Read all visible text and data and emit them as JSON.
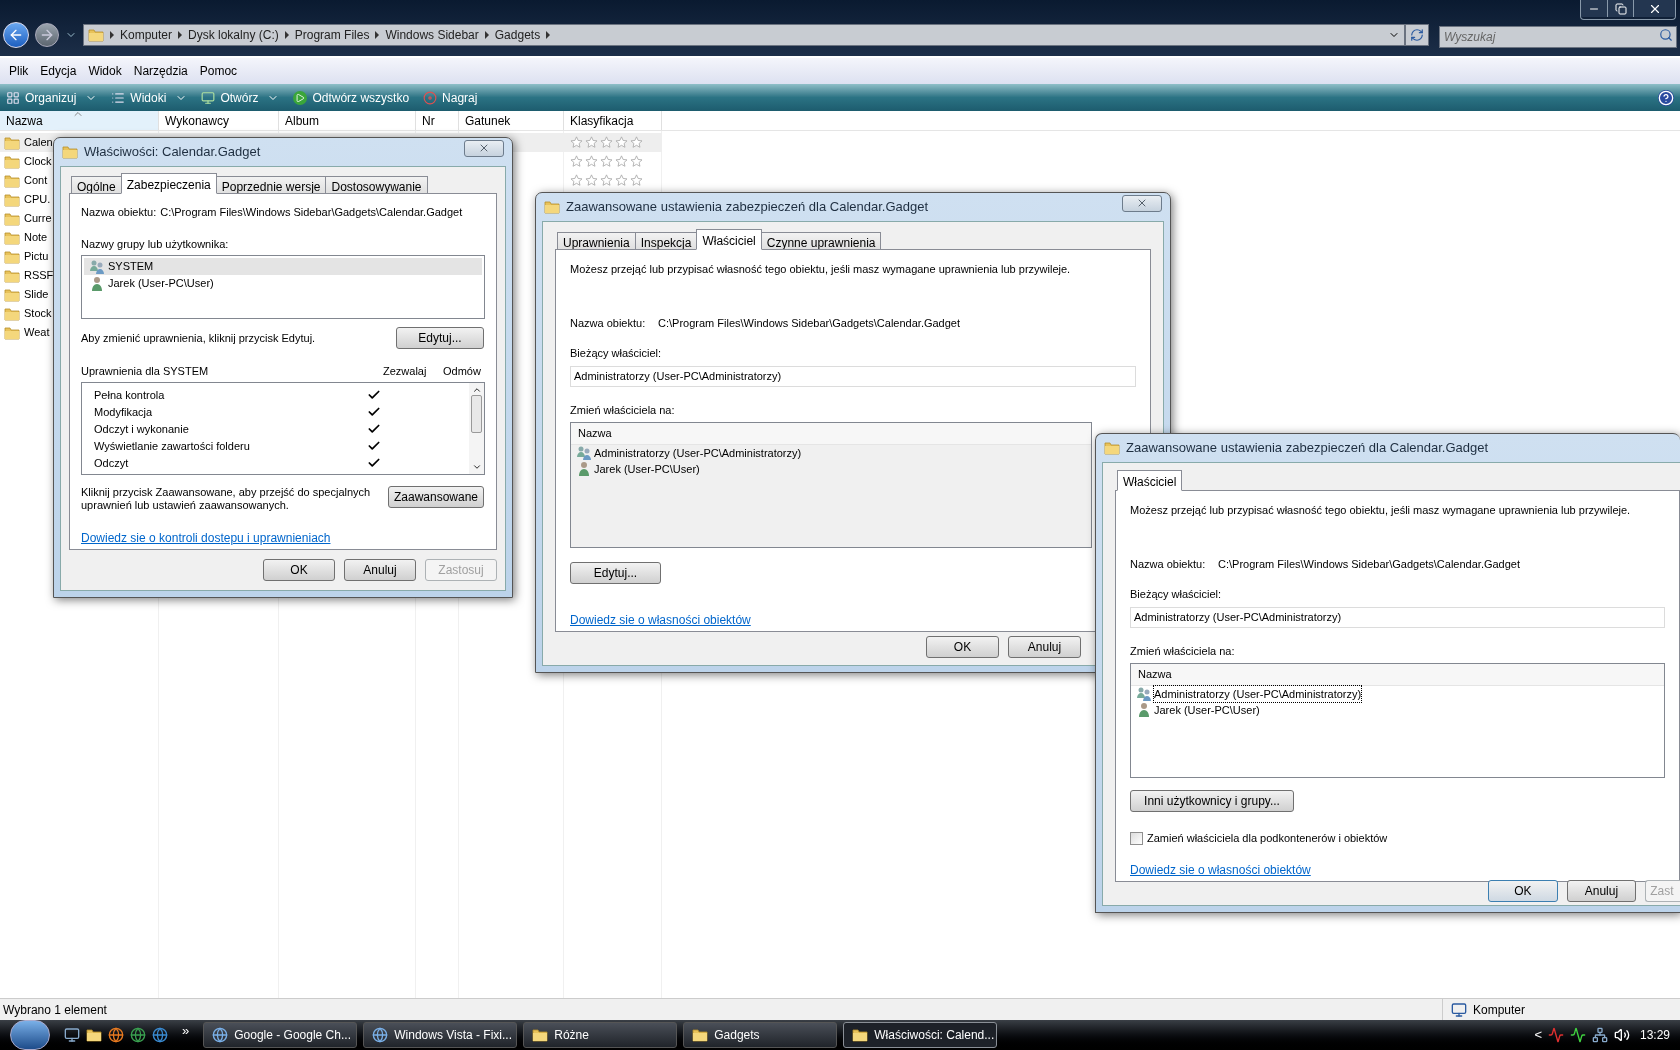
{
  "explorer": {
    "address": [
      "Komputer",
      "Dysk lokalny (C:)",
      "Program Files",
      "Windows Sidebar",
      "Gadgets"
    ],
    "search": {
      "placeholder": "Wyszukaj"
    },
    "menu": [
      "Plik",
      "Edycja",
      "Widok",
      "Narzędzia",
      "Pomoc"
    ],
    "toolbar": [
      {
        "label": "Organizuj",
        "kind": "organize",
        "dropdown": true
      },
      {
        "label": "Widoki",
        "kind": "views",
        "dropdown": true
      },
      {
        "label": "Otwórz",
        "kind": "open",
        "dropdown": true
      },
      {
        "label": "Odtwórz wszystko",
        "kind": "play",
        "dropdown": false
      },
      {
        "label": "Nagraj",
        "kind": "burn",
        "dropdown": false
      }
    ],
    "columns": [
      {
        "label": "Nazwa",
        "sorted": true
      },
      {
        "label": "Wykonawcy",
        "sorted": false
      },
      {
        "label": "Album",
        "sorted": false
      },
      {
        "label": "Nr",
        "sorted": false
      },
      {
        "label": "Gatunek",
        "sorted": false
      },
      {
        "label": "Klasyfikacja",
        "sorted": false
      }
    ],
    "files": [
      {
        "name": "Calen",
        "selected": true,
        "stars": 0
      },
      {
        "name": "Clock",
        "selected": false,
        "stars": 0
      },
      {
        "name": "Cont",
        "selected": false,
        "stars": 0
      },
      {
        "name": "CPU.",
        "selected": false
      },
      {
        "name": "Curre",
        "selected": false
      },
      {
        "name": "Note",
        "selected": false
      },
      {
        "name": "Pictu",
        "selected": false
      },
      {
        "name": "RSSF",
        "selected": false
      },
      {
        "name": "Slide",
        "selected": false
      },
      {
        "name": "Stock",
        "selected": false
      },
      {
        "name": "Weat",
        "selected": false
      }
    ],
    "status_bar": {
      "selection": "Wybrano 1 element",
      "location": "Komputer"
    }
  },
  "properties_dialog": {
    "title": "Właściwości: Calendar.Gadget",
    "tabs": [
      {
        "label": "Ogólne",
        "selected": false
      },
      {
        "label": "Zabezpieczenia",
        "selected": true
      },
      {
        "label": "Poprzednie wersje",
        "selected": false
      },
      {
        "label": "Dostosowywanie",
        "selected": false
      }
    ],
    "object_label": "Nazwa obiektu:",
    "object_name": "C:\\Program Files\\Windows Sidebar\\Gadgets\\Calendar.Gadget",
    "users_label": "Nazwy grupy lub użytkownika:",
    "users": [
      {
        "name": "SYSTEM",
        "kind": "group",
        "selected": true
      },
      {
        "name": "Jarek (User-PC\\User)",
        "kind": "user",
        "selected": false
      }
    ],
    "edit_hint": "Aby zmienić uprawnienia, kliknij przycisk Edytuj.",
    "edit_button": "Edytuj...",
    "permissions_label": "Uprawnienia dla SYSTEM",
    "allow_label": "Zezwalaj",
    "deny_label": "Odmów",
    "permissions": [
      {
        "name": "Pełna kontrola",
        "allow": true,
        "deny": false
      },
      {
        "name": "Modyfikacja",
        "allow": true,
        "deny": false
      },
      {
        "name": "Odczyt i wykonanie",
        "allow": true,
        "deny": false
      },
      {
        "name": "Wyświetlanie zawartości folderu",
        "allow": true,
        "deny": false
      },
      {
        "name": "Odczyt",
        "allow": true,
        "deny": false
      }
    ],
    "advanced_hint": "Kliknij przycisk Zaawansowane, aby przejść do specjalnych uprawnień lub ustawień zaawansowanych.",
    "advanced_button": "Zaawansowane",
    "link": "Dowiedz sie o kontroli dostepu i uprawnieniach",
    "buttons": [
      {
        "label": "OK",
        "disabled": false
      },
      {
        "label": "Anuluj",
        "disabled": false
      },
      {
        "label": "Zastosuj",
        "disabled": true
      }
    ]
  },
  "advanced_dialog": {
    "title": "Zaawansowane ustawienia zabezpieczeń dla Calendar.Gadget",
    "tabs": [
      {
        "label": "Uprawnienia",
        "selected": false
      },
      {
        "label": "Inspekcja",
        "selected": false
      },
      {
        "label": "Właściciel",
        "selected": true
      },
      {
        "label": "Czynne uprawnienia",
        "selected": false
      }
    ],
    "intro": "Możesz przejąć lub przypisać własność tego obiektu, jeśli masz wymagane uprawnienia lub przywileje.",
    "object_label": "Nazwa obiektu:",
    "object_name": "C:\\Program Files\\Windows Sidebar\\Gadgets\\Calendar.Gadget",
    "owner_label": "Bieżący właściciel:",
    "owner": "Administratorzy (User-PC\\Administratorzy)",
    "change_label": "Zmień właściciela na:",
    "list_header": "Nazwa",
    "candidates": [
      {
        "name": "Administratorzy (User-PC\\Administratorzy)",
        "kind": "group"
      },
      {
        "name": "Jarek (User-PC\\User)",
        "kind": "user"
      }
    ],
    "edit_button": "Edytuj...",
    "link": "Dowiedz sie o własności obiektów",
    "buttons": [
      {
        "label": "OK"
      },
      {
        "label": "Anuluj"
      }
    ]
  },
  "owner_dialog": {
    "title": "Zaawansowane ustawienia zabezpieczeń dla Calendar.Gadget",
    "tabs": [
      {
        "label": "Właściciel",
        "selected": true
      }
    ],
    "intro": "Możesz przejąć lub przypisać własność tego obiektu, jeśli masz wymagane uprawnienia lub przywileje.",
    "object_label": "Nazwa obiektu:",
    "object_name": "C:\\Program Files\\Windows Sidebar\\Gadgets\\Calendar.Gadget",
    "owner_label": "Bieżący właściciel:",
    "owner": "Administratorzy (User-PC\\Administratorzy)",
    "change_label": "Zmień właściciela na:",
    "list_header": "Nazwa",
    "candidates": [
      {
        "name": "Administratorzy (User-PC\\Administratorzy)",
        "kind": "group",
        "focused": true
      },
      {
        "name": "Jarek (User-PC\\User)",
        "kind": "user",
        "focused": false
      }
    ],
    "other_button": "Inni użytkownicy i grupy...",
    "replace_option": {
      "label": "Zamień właściciela dla podkontenerów i obiektów",
      "checked": false
    },
    "link": "Dowiedz sie o własności obiektów",
    "buttons": [
      {
        "label": "OK",
        "default": true,
        "disabled": false
      },
      {
        "label": "Anuluj",
        "default": false,
        "disabled": false
      },
      {
        "label": "Zast",
        "default": false,
        "disabled": true
      }
    ]
  },
  "taskbar": {
    "more": "»",
    "tasks": [
      {
        "label": "Google - Google Ch...",
        "kind": "browser",
        "selected": false
      },
      {
        "label": "Windows Vista - Fixi...",
        "kind": "browser",
        "selected": false
      },
      {
        "label": "Różne",
        "kind": "folder",
        "selected": false
      },
      {
        "label": "Gadgets",
        "kind": "folder",
        "selected": false
      },
      {
        "label": "Właściwości: Calend...",
        "kind": "folder",
        "selected": true
      }
    ],
    "tray_toggle": "<",
    "clock": "13:29"
  }
}
